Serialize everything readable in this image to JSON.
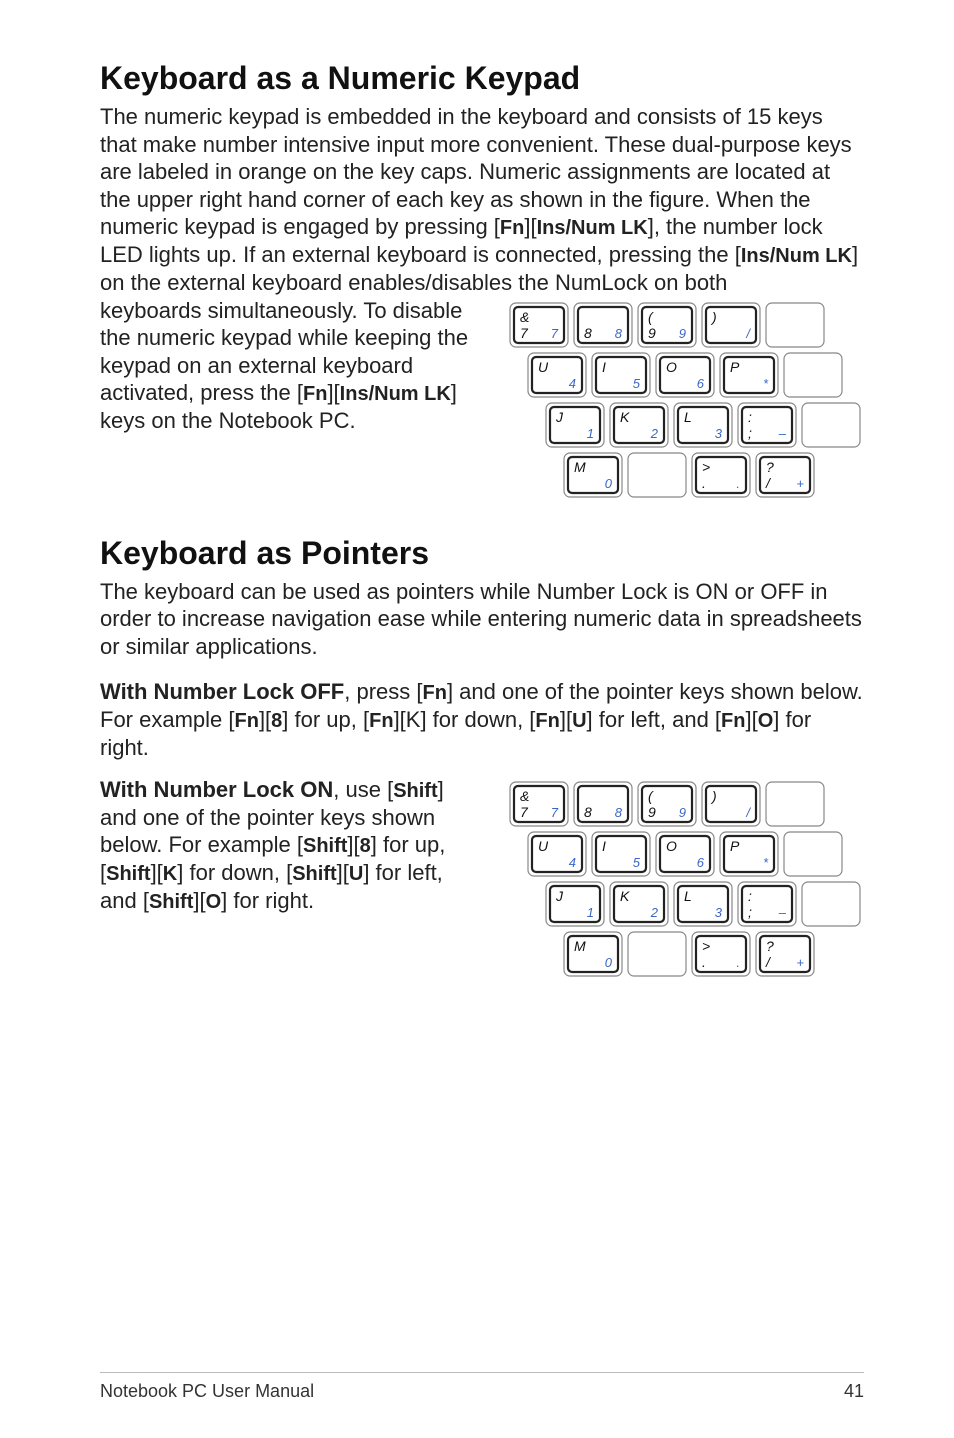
{
  "section1": {
    "title": "Keyboard as a Numeric Keypad",
    "p1a": "The numeric keypad is embedded in the keyboard and consists of 15 keys that make number intensive input more convenient. These dual-purpose keys are labeled in orange on the key caps. Numeric assignments are located at the upper right hand corner of each key as shown in the figure. When the numeric keypad is engaged by pressing [",
    "k1": "Fn",
    "p1b": "][",
    "k2": "Ins/Num LK",
    "p1c": "], the number lock LED lights up. If an external keyboard is connected, pressing the [",
    "k3": "Ins/Num LK",
    "p1d": "] on the external keyboard enables/disables the NumLock on both ",
    "p1e_a": "keyboards simultaneously. To disable the numeric keypad while keeping the keypad on an external keyboard activated, press the [",
    "k4": "Fn",
    "p1e_b": "][",
    "k5": "Ins/Num LK",
    "p1e_c": "] keys on the Notebook PC."
  },
  "section2": {
    "title": "Keyboard as Pointers",
    "p1": "The keyboard can be used as pointers while Number Lock is ON or OFF in order to increase navigation ease while entering numeric data in spreadsheets or similar applications.",
    "p2_a": "With Number Lock OFF",
    "p2_b": ", press [",
    "k1": "Fn",
    "p2_c": "] and one of the pointer keys shown below. For example [",
    "k2": "Fn",
    "p2_d": "][",
    "k3": "8",
    "p2_e": "] for up, [",
    "k4": "Fn",
    "p2_f": "][K] for down, [",
    "k5": "Fn",
    "p2_g": "][",
    "k6": "U",
    "p2_h": "] for left, and [",
    "k7": "Fn",
    "p2_i": "][",
    "k8": "O",
    "p2_j": "] for right.",
    "p3_a": "With Number Lock ON",
    "p3_b": ", use [",
    "k9": "Shift",
    "p3_c": "] and one of the pointer keys shown below. For example [",
    "k10": "Shift",
    "p3_d": "][",
    "k11": "8",
    "p3_e": "] for up, [",
    "k12": "Shift",
    "p3_f": "][",
    "k13": "K",
    "p3_g": "] for down, [",
    "k14": "Shift",
    "p3_h": "][",
    "k15": "U",
    "p3_i": "] for left, and [",
    "k16": "Shift",
    "p3_j": "][",
    "k17": "O",
    "p3_k": "] for right."
  },
  "keyboard": {
    "rows": [
      [
        {
          "main": "&",
          "sub": "7",
          "num": "7"
        },
        {
          "main": "",
          "sub": "8",
          "num": "8"
        },
        {
          "main": "(",
          "sub": "9",
          "num": "9"
        },
        {
          "main": ")",
          "sub": "",
          "num": "/"
        },
        {
          "blank": true
        }
      ],
      [
        {
          "main": "U",
          "sub": "",
          "num": "4"
        },
        {
          "main": "I",
          "sub": "",
          "num": "5"
        },
        {
          "main": "O",
          "sub": "",
          "num": "6"
        },
        {
          "main": "P",
          "sub": "",
          "num": "*"
        },
        {
          "blank": true
        }
      ],
      [
        {
          "main": "J",
          "sub": "",
          "num": "1"
        },
        {
          "main": "K",
          "sub": "",
          "num": "2"
        },
        {
          "main": "L",
          "sub": "",
          "num": "3"
        },
        {
          "main": ":",
          "sub": ";",
          "num": "–"
        },
        {
          "blank": true
        }
      ],
      [
        {
          "main": "M",
          "sub": "",
          "num": "0"
        },
        {
          "blank": true
        },
        {
          "main": ">",
          "sub": ".",
          "num": "."
        },
        {
          "main": "?",
          "sub": "/",
          "num": "+"
        },
        null
      ]
    ],
    "row_offsets": [
      0,
      18,
      36,
      54
    ]
  },
  "footer": {
    "left": "Notebook PC User Manual",
    "right": "41"
  }
}
